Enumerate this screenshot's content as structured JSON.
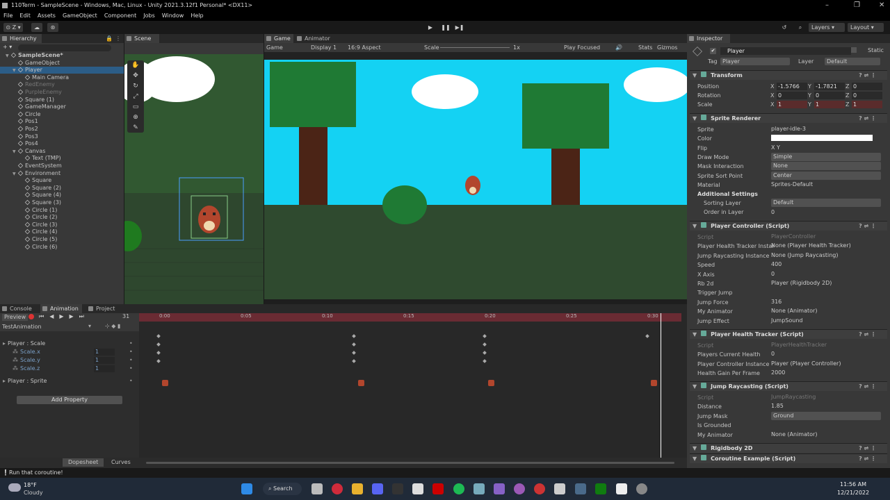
{
  "window": {
    "title": "110Term - SampleScene - Windows, Mac, Linux - Unity 2021.3.12f1 Personal* <DX11>"
  },
  "menu": [
    "File",
    "Edit",
    "Assets",
    "GameObject",
    "Component",
    "Jobs",
    "Window",
    "Help"
  ],
  "toolbar": {
    "layers": "Layers",
    "layout": "Layout"
  },
  "hierarchy": {
    "tab": "Hierarchy",
    "items": [
      {
        "label": "SampleScene*",
        "depth": 0,
        "bold": true
      },
      {
        "label": "GameObject",
        "depth": 1
      },
      {
        "label": "Player",
        "depth": 1,
        "selected": true
      },
      {
        "label": "Main Camera",
        "depth": 2
      },
      {
        "label": "RedEnemy",
        "depth": 1,
        "dim": true
      },
      {
        "label": "PurpleEnemy",
        "depth": 1,
        "dim": true
      },
      {
        "label": "Square (1)",
        "depth": 1
      },
      {
        "label": "GameManager",
        "depth": 1
      },
      {
        "label": "Circle",
        "depth": 1
      },
      {
        "label": "Pos1",
        "depth": 1
      },
      {
        "label": "Pos2",
        "depth": 1
      },
      {
        "label": "Pos3",
        "depth": 1
      },
      {
        "label": "Pos4",
        "depth": 1
      },
      {
        "label": "Canvas",
        "depth": 1
      },
      {
        "label": "Text (TMP)",
        "depth": 2
      },
      {
        "label": "EventSystem",
        "depth": 1
      },
      {
        "label": "Environment",
        "depth": 1
      },
      {
        "label": "Square",
        "depth": 2
      },
      {
        "label": "Square (2)",
        "depth": 2
      },
      {
        "label": "Square (4)",
        "depth": 2
      },
      {
        "label": "Square (3)",
        "depth": 2
      },
      {
        "label": "Circle (1)",
        "depth": 2
      },
      {
        "label": "Circle (2)",
        "depth": 2
      },
      {
        "label": "Circle (3)",
        "depth": 2
      },
      {
        "label": "Circle (4)",
        "depth": 2
      },
      {
        "label": "Circle (5)",
        "depth": 2
      },
      {
        "label": "Circle (6)",
        "depth": 2
      }
    ]
  },
  "scene": {
    "tab": "Scene"
  },
  "game": {
    "tab": "Game",
    "tab2": "Animator",
    "mode": "Game",
    "display": "Display 1",
    "aspect": "16:9 Aspect",
    "scale_label": "Scale",
    "scale_value": "1x",
    "play_focused": "Play Focused",
    "stats": "Stats",
    "gizmos": "Gizmos"
  },
  "animation": {
    "tabs": [
      "Console",
      "Animation",
      "Project"
    ],
    "preview": "Preview",
    "frame": "31",
    "clip": "TestAnimation",
    "ticks": [
      "0:00",
      "0:05",
      "0:10",
      "0:15",
      "0:20",
      "0:25",
      "0:30"
    ],
    "props": [
      {
        "label": "Player : Scale",
        "value": "",
        "indent": 0
      },
      {
        "label": "Scale.x",
        "value": "1",
        "indent": 1
      },
      {
        "label": "Scale.y",
        "value": "1",
        "indent": 1
      },
      {
        "label": "Scale.z",
        "value": "1",
        "indent": 1
      },
      {
        "label": "Player : Sprite",
        "value": "",
        "indent": 0
      }
    ],
    "add_property": "Add Property",
    "dopesheet": "Dopesheet",
    "curves": "Curves"
  },
  "inspector": {
    "tab": "Inspector",
    "object": "Player",
    "static": "Static",
    "tag_label": "Tag",
    "tag": "Player",
    "layer_label": "Layer",
    "layer": "Default",
    "transform": {
      "title": "Transform",
      "position": [
        "-1.5766",
        "-1.7821",
        "0"
      ],
      "rotation": [
        "0",
        "0",
        "0"
      ],
      "scale": [
        "1",
        "1",
        "1"
      ],
      "labels": [
        "Position",
        "Rotation",
        "Scale"
      ]
    },
    "sprite_renderer": {
      "title": "Sprite Renderer",
      "rows": [
        {
          "label": "Sprite",
          "value": "player-idle-3"
        },
        {
          "label": "Color",
          "value": ""
        },
        {
          "label": "Flip",
          "value": "X   Y"
        },
        {
          "label": "Draw Mode",
          "value": "Simple"
        },
        {
          "label": "Mask Interaction",
          "value": "None"
        },
        {
          "label": "Sprite Sort Point",
          "value": "Center"
        },
        {
          "label": "Material",
          "value": "Sprites-Default"
        }
      ],
      "additional": "Additional Settings",
      "sorting_label": "Sorting Layer",
      "sorting": "Default",
      "order_label": "Order in Layer",
      "order": "0"
    },
    "player_controller": {
      "title": "Player Controller (Script)",
      "rows": [
        {
          "label": "Script",
          "value": "PlayerController",
          "dim": true
        },
        {
          "label": "Player Health Tracker Instar",
          "value": "None (Player Health Tracker)"
        },
        {
          "label": "Jump Raycasting Instance",
          "value": "None (Jump Raycasting)"
        },
        {
          "label": "Speed",
          "value": "400"
        },
        {
          "label": "X Axis",
          "value": "0"
        },
        {
          "label": "Rb 2d",
          "value": "Player (Rigidbody 2D)"
        },
        {
          "label": "Trigger Jump",
          "value": ""
        },
        {
          "label": "Jump Force",
          "value": "316"
        },
        {
          "label": "My Animator",
          "value": "None (Animator)"
        },
        {
          "label": "Jump Effect",
          "value": "JumpSound"
        }
      ]
    },
    "health_tracker": {
      "title": "Player Health Tracker (Script)",
      "rows": [
        {
          "label": "Script",
          "value": "PlayerHealthTracker",
          "dim": true
        },
        {
          "label": "Players Current Health",
          "value": "0"
        },
        {
          "label": "Player Controller Instance",
          "value": "Player (Player Controller)"
        },
        {
          "label": "Health Gain Per Frame",
          "value": "2000"
        }
      ]
    },
    "jump_raycasting": {
      "title": "Jump Raycasting (Script)",
      "rows": [
        {
          "label": "Script",
          "value": "JumpRaycasting",
          "dim": true
        },
        {
          "label": "Distance",
          "value": "1.85"
        },
        {
          "label": "Jump Mask",
          "value": "Ground"
        },
        {
          "label": "Is Grounded",
          "value": ""
        },
        {
          "label": "My Animator",
          "value": "None (Animator)"
        }
      ]
    },
    "rigidbody": {
      "title": "Rigidbody 2D"
    },
    "coroutine": {
      "title": "Coroutine Example (Script)"
    }
  },
  "status": {
    "message": "Run that coroutine!"
  },
  "taskbar": {
    "temp": "18°F",
    "weather": "Cloudy",
    "search": "Search",
    "time": "11:56 AM",
    "date": "12/21/2022"
  }
}
